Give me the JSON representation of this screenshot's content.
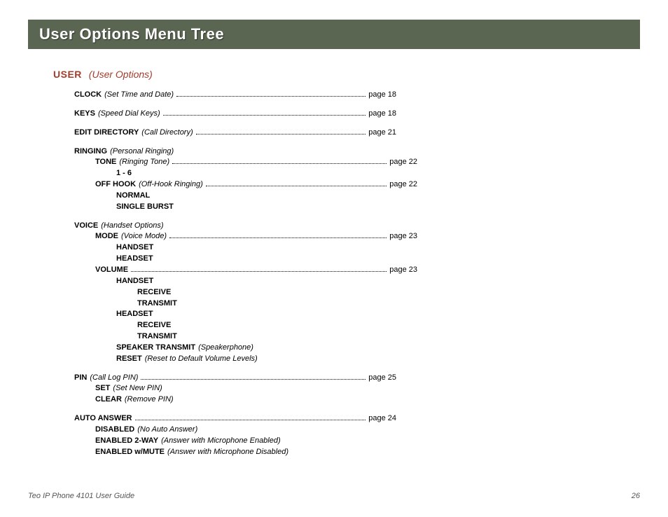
{
  "title": "User Options Menu Tree",
  "header": {
    "main": "USER",
    "sub": "(User Options)"
  },
  "c": {
    "clock": {
      "l": "CLOCK",
      "d": "(Set Time and Date)",
      "p": "page 18"
    },
    "keys": {
      "l": "KEYS",
      "d": "(Speed Dial Keys)",
      "p": "page 18"
    },
    "edit_dir": {
      "l": "EDIT DIRECTORY",
      "d": "(Call Directory)",
      "p": "page 21"
    },
    "ringing": {
      "l": "RINGING",
      "d": "(Personal Ringing)"
    },
    "tone": {
      "l": "TONE",
      "d": "(Ringing Tone)",
      "p": "page 22"
    },
    "tone_range": {
      "l": "1 - 6"
    },
    "offhook": {
      "l": "OFF HOOK",
      "d": "(Off-Hook Ringing)",
      "p": "page 22"
    },
    "normal": {
      "l": "NORMAL"
    },
    "single_burst": {
      "l": "SINGLE BURST"
    },
    "voice": {
      "l": "VOICE",
      "d": "(Handset Options)"
    },
    "mode": {
      "l": "MODE",
      "d": "(Voice Mode)",
      "p": "page 23"
    },
    "handset": {
      "l": "HANDSET"
    },
    "headset": {
      "l": "HEADSET"
    },
    "volume": {
      "l": "VOLUME",
      "p": "page 23"
    },
    "v_handset": {
      "l": "HANDSET"
    },
    "v_receive1": {
      "l": "RECEIVE"
    },
    "v_transmit1": {
      "l": "TRANSMIT"
    },
    "v_headset": {
      "l": "HEADSET"
    },
    "v_receive2": {
      "l": "RECEIVE"
    },
    "v_transmit2": {
      "l": "TRANSMIT"
    },
    "speaker": {
      "l": "SPEAKER TRANSMIT",
      "d": "(Speakerphone)"
    },
    "reset": {
      "l": "RESET",
      "d": "(Reset to Default Volume Levels)"
    },
    "pin": {
      "l": "PIN",
      "d": "(Call Log PIN)",
      "p": "page 25"
    },
    "pin_set": {
      "l": "SET",
      "d": "(Set New PIN)"
    },
    "pin_clear": {
      "l": "CLEAR",
      "d": "(Remove PIN)"
    },
    "auto": {
      "l": "AUTO ANSWER",
      "p": "page 24"
    },
    "disabled": {
      "l": "DISABLED",
      "d": "(No Auto Answer)"
    },
    "en2way": {
      "l": "ENABLED 2-WAY",
      "d": "(Answer with Microphone Enabled)"
    },
    "enmute": {
      "l": "ENABLED w/MUTE",
      "d": "(Answer with Microphone Disabled)"
    }
  },
  "footer": {
    "left": "Teo IP Phone 4101 User Guide",
    "right": "26"
  }
}
